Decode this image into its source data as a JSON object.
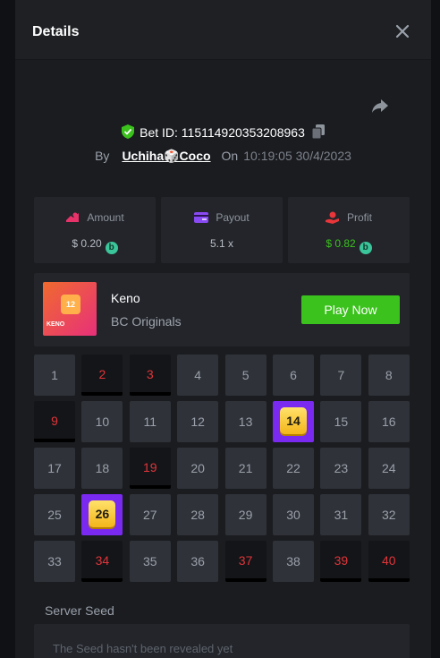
{
  "dialog": {
    "title": "Details"
  },
  "bet": {
    "id_label": "Bet ID: 115114920353208963",
    "by_label": "By",
    "user": "Uchiha🎲Coco",
    "on_label": "On",
    "time": "10:19:05 30/4/2023"
  },
  "stats": {
    "amount": {
      "label": "Amount",
      "value": "$ 0.20",
      "coin": "b"
    },
    "payout": {
      "label": "Payout",
      "value": "5.1 x"
    },
    "profit": {
      "label": "Profit",
      "value": "$ 0.82",
      "coin": "b"
    }
  },
  "game": {
    "name": "Keno",
    "provider": "BC Originals",
    "thumb_number": "12",
    "thumb_text": "KENO",
    "play_label": "Play Now"
  },
  "keno": {
    "numbers": [
      "1",
      "2",
      "3",
      "4",
      "5",
      "6",
      "7",
      "8",
      "9",
      "10",
      "11",
      "12",
      "13",
      "14",
      "15",
      "16",
      "17",
      "18",
      "19",
      "20",
      "21",
      "22",
      "23",
      "24",
      "25",
      "26",
      "27",
      "28",
      "29",
      "30",
      "31",
      "32",
      "33",
      "34",
      "35",
      "36",
      "37",
      "38",
      "39",
      "40"
    ],
    "picked": [
      "2",
      "3",
      "9",
      "19",
      "34",
      "37",
      "39",
      "40"
    ],
    "hits": [
      "14",
      "26"
    ]
  },
  "seed": {
    "label": "Server Seed",
    "text": "The Seed hasn't been revealed yet"
  },
  "colors": {
    "accent_green": "#3bc21d",
    "hit_purple": "#7a2af0",
    "picked_red": "#e0353a",
    "profit_green": "#3bc21d"
  },
  "icons": [
    "close-icon",
    "share-icon",
    "shield-check-icon",
    "copy-icon",
    "amount-icon",
    "payout-icon",
    "profit-icon",
    "coin-icon"
  ]
}
